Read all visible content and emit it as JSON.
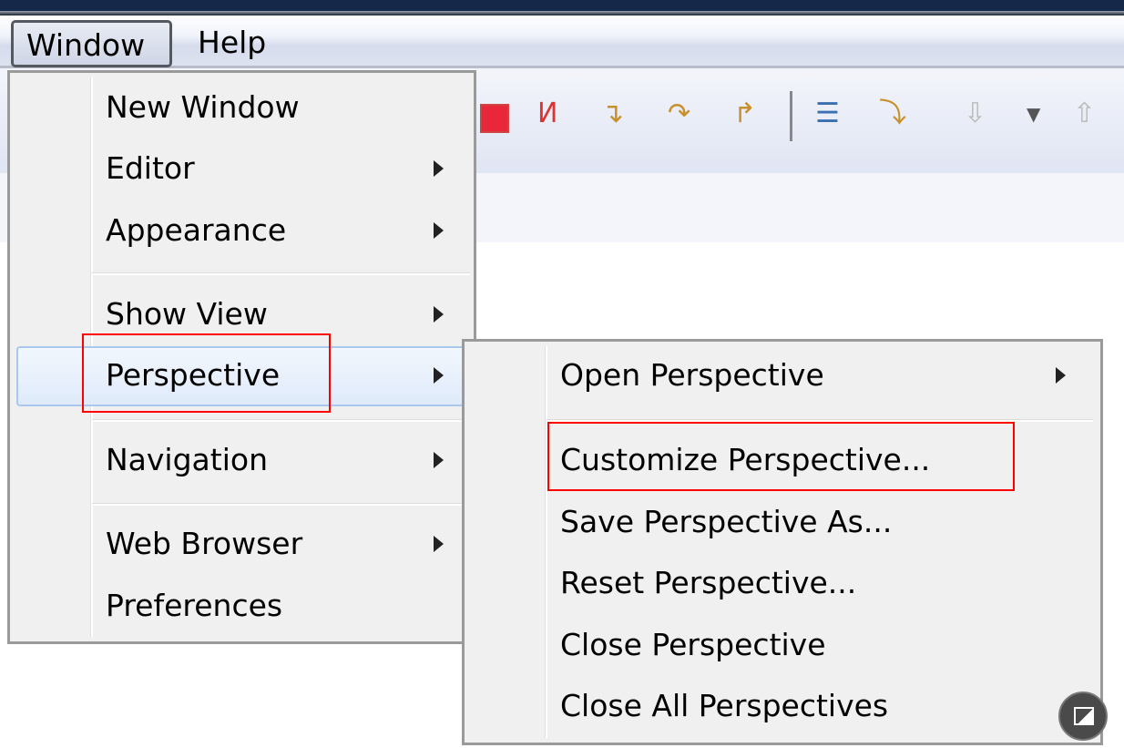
{
  "menubar": {
    "items": [
      {
        "label": "Window"
      },
      {
        "label": "Help"
      }
    ]
  },
  "toolbar": {
    "icons": [
      "terminate-icon",
      "disconnect-icon",
      "step-into-icon",
      "step-over-icon",
      "step-return-icon",
      "drop-to-frame-icon",
      "use-step-filters-icon",
      "next-annotation-icon",
      "dropdown-icon",
      "previous-annotation-icon"
    ]
  },
  "window_menu": {
    "items": [
      {
        "label": "New Window",
        "submenu": false
      },
      {
        "label": "Editor",
        "submenu": true
      },
      {
        "label": "Appearance",
        "submenu": true
      },
      {
        "label": "Show View",
        "submenu": true
      },
      {
        "label": "Perspective",
        "submenu": true,
        "highlighted": true
      },
      {
        "label": "Navigation",
        "submenu": true
      },
      {
        "label": "Web Browser",
        "submenu": true
      },
      {
        "label": "Preferences",
        "submenu": false
      }
    ]
  },
  "perspective_submenu": {
    "items": [
      {
        "label": "Open Perspective",
        "submenu": true
      },
      {
        "label": "Customize Perspective...",
        "submenu": false
      },
      {
        "label": "Save Perspective As...",
        "submenu": false
      },
      {
        "label": "Reset Perspective...",
        "submenu": false
      },
      {
        "label": "Close Perspective",
        "submenu": false
      },
      {
        "label": "Close All Perspectives",
        "submenu": false
      }
    ]
  },
  "annotations": {
    "color": "#ff0000",
    "boxes": [
      "Perspective",
      "Customize Perspective..."
    ]
  }
}
